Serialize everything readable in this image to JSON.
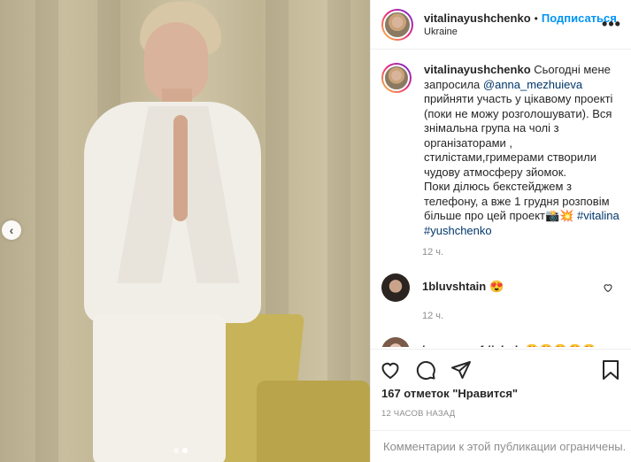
{
  "photo": {
    "nav_prev_icon": "chevron-left-icon",
    "nav_prev_glyph": "‹",
    "dots_count": 2,
    "active_dot": 1
  },
  "header": {
    "username": "vitalinayushchenko",
    "separator": "•",
    "follow_label": "Подписаться",
    "location": "Ukraine",
    "more_glyph": "•••"
  },
  "caption": {
    "username": "vitalinayushchenko",
    "text_1": " Сьогодні мене запросила ",
    "mention": "@anna_mezhuieva",
    "text_2": " прийняти участь у цікавому проекті (поки не можу розголошувати). Вся знімальна група на чолі з організаторами , стилістами,гримерами створили чудову атмосферу зйомок.",
    "text_3": "Поки ділюсь бекстейджем з телефону, а вже 1 грудня розповім більше про цей проект📸💥",
    "hashtag_1": "#vitalina",
    "hashtag_2": "#yushchenko",
    "time": "12 ч."
  },
  "comments": [
    {
      "username": "1bluvshtain",
      "text": "😍",
      "time": "12 ч."
    },
    {
      "username": "ivannaonufriichuk",
      "text": "😍😍😍😍😍😍",
      "time": ""
    }
  ],
  "actions": {
    "likes_text": "167 отметок \"Нравится\"",
    "time_ago": "12 часов назад"
  },
  "footer": {
    "closed_text": "Комментарии к этой публикации ограничены."
  },
  "colors": {
    "accent": "#0095f6",
    "link": "#00376b",
    "muted": "#8e8e8e",
    "text": "#262626"
  }
}
